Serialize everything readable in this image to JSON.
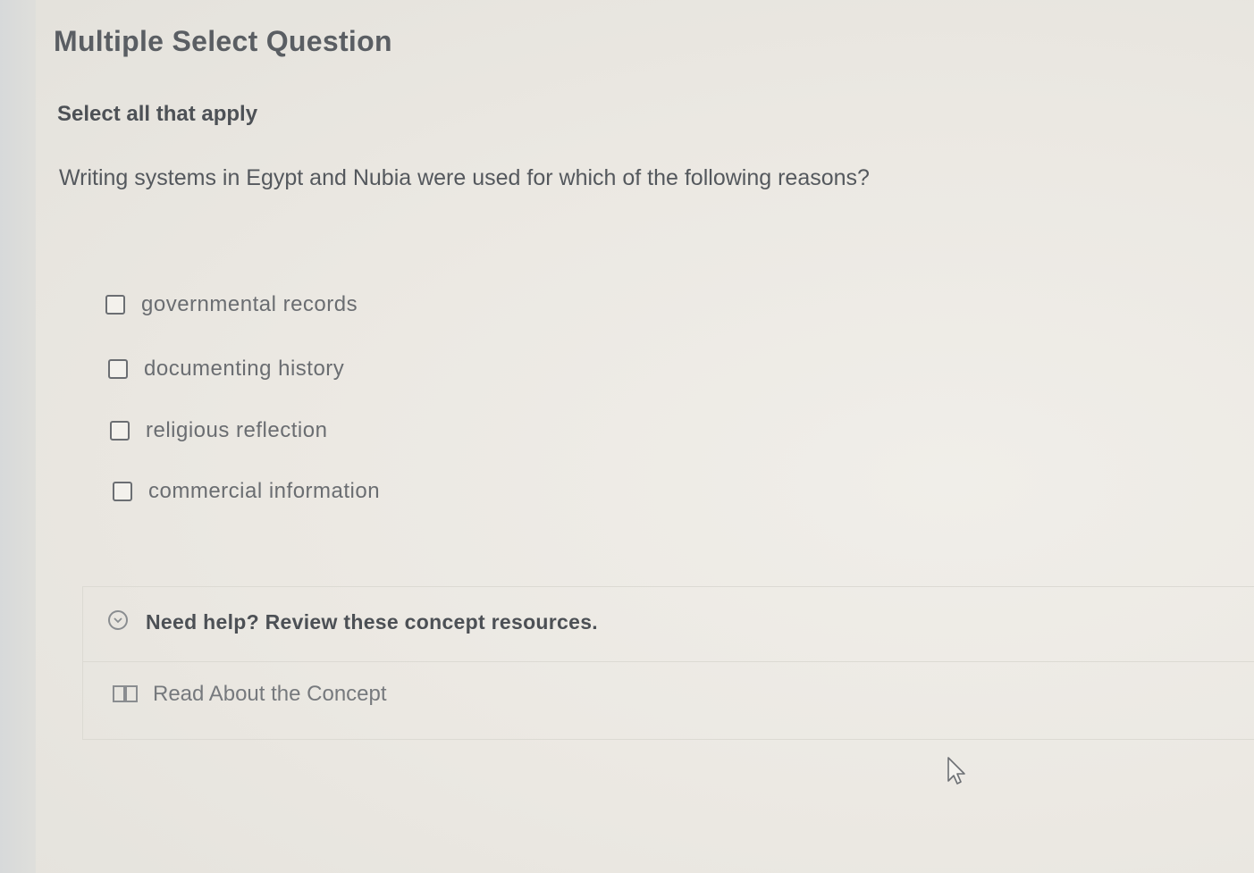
{
  "question_panel": {
    "title": "Multiple Select Question",
    "instruction": "Select all that apply",
    "question_text": "Writing systems in Egypt and Nubia were used for which of the following reasons?",
    "options": [
      {
        "label": "governmental records",
        "checked": false
      },
      {
        "label": "documenting history",
        "checked": false
      },
      {
        "label": "religious reflection",
        "checked": false
      },
      {
        "label": "commercial information",
        "checked": false
      }
    ]
  },
  "help": {
    "header_icon": "chevron-down-circle-icon",
    "title": "Need help? Review these concept resources.",
    "resources": [
      {
        "icon": "book-icon",
        "label": "Read About the Concept"
      }
    ]
  },
  "colors": {
    "background": "#e9e6df",
    "text": "#4a4d52",
    "checkbox_border": "#6b6e72"
  }
}
